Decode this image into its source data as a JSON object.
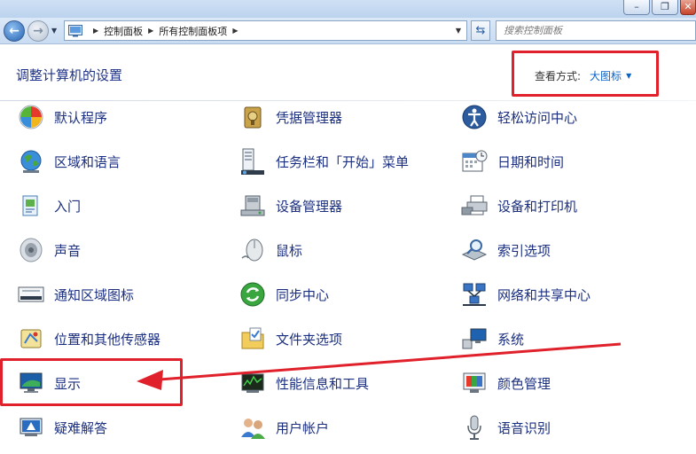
{
  "window": {
    "controls": [
      "minimize",
      "maximize",
      "close"
    ]
  },
  "nav": {
    "breadcrumbs": [
      "控制面板",
      "所有控制面板项"
    ],
    "search_placeholder": "搜索控制面板"
  },
  "header": {
    "title": "调整计算机的设置",
    "view_by_label": "查看方式:",
    "view_by_value": "大图标"
  },
  "items": [
    {
      "label": "默认程序",
      "icon": "default-programs-icon"
    },
    {
      "label": "凭据管理器",
      "icon": "credential-manager-icon"
    },
    {
      "label": "轻松访问中心",
      "icon": "ease-of-access-icon"
    },
    {
      "label": "区域和语言",
      "icon": "region-language-icon"
    },
    {
      "label": "任务栏和「开始」菜单",
      "icon": "taskbar-start-menu-icon"
    },
    {
      "label": "日期和时间",
      "icon": "date-time-icon"
    },
    {
      "label": "入门",
      "icon": "getting-started-icon"
    },
    {
      "label": "设备管理器",
      "icon": "device-manager-icon"
    },
    {
      "label": "设备和打印机",
      "icon": "devices-printers-icon"
    },
    {
      "label": "声音",
      "icon": "sound-icon"
    },
    {
      "label": "鼠标",
      "icon": "mouse-icon"
    },
    {
      "label": "索引选项",
      "icon": "indexing-options-icon"
    },
    {
      "label": "通知区域图标",
      "icon": "notification-area-icon"
    },
    {
      "label": "同步中心",
      "icon": "sync-center-icon"
    },
    {
      "label": "网络和共享中心",
      "icon": "network-sharing-icon"
    },
    {
      "label": "位置和其他传感器",
      "icon": "location-sensors-icon"
    },
    {
      "label": "文件夹选项",
      "icon": "folder-options-icon"
    },
    {
      "label": "系统",
      "icon": "system-icon"
    },
    {
      "label": "显示",
      "icon": "display-icon"
    },
    {
      "label": "性能信息和工具",
      "icon": "performance-tools-icon"
    },
    {
      "label": "颜色管理",
      "icon": "color-management-icon"
    },
    {
      "label": "疑难解答",
      "icon": "troubleshooting-icon"
    },
    {
      "label": "用户帐户",
      "icon": "user-accounts-icon"
    },
    {
      "label": "语音识别",
      "icon": "speech-recognition-icon"
    }
  ],
  "colors": {
    "link_text": "#1b2f80",
    "title_text": "#1e3287",
    "annotation_red": "#e0212b",
    "view_value": "#0b63c6"
  }
}
